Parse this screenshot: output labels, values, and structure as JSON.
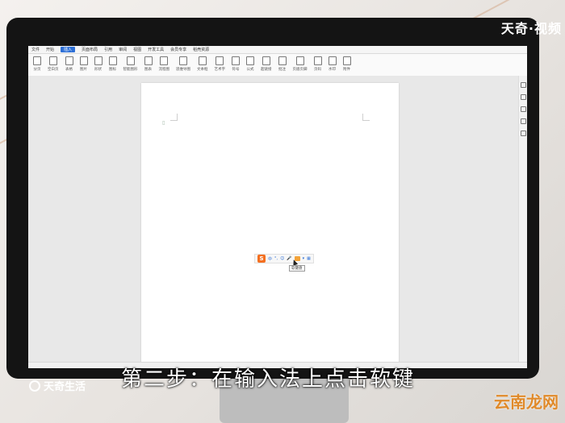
{
  "watermark": "天奇·视频",
  "corner_logo": "天奇生活",
  "subtitle": "第二步：在输入法上点击软键",
  "site_mark": "云南龙网",
  "app": {
    "tabs": [
      "文件",
      "开始",
      "插入",
      "页面布局",
      "引用",
      "审阅",
      "视图",
      "开发工具",
      "会员专享",
      "稻壳资源"
    ],
    "active_tab": "插入",
    "ribbon": [
      "分页",
      "空白页",
      "表格",
      "图片",
      "形状",
      "图标",
      "智能图形",
      "图表",
      "流程图",
      "思维导图",
      "文本框",
      "艺术字",
      "符号",
      "公式",
      "超链接",
      "批注",
      "页眉页脚",
      "页码",
      "水印",
      "附件"
    ],
    "ime_logo": "S",
    "ime_items": [
      "中",
      "°,",
      "☺",
      "🎤"
    ],
    "tooltip": "软键盘"
  },
  "colors": {
    "accent": "#2d6fd6",
    "ime_orange": "#f46f20",
    "site_mark": "#e08a2a"
  }
}
